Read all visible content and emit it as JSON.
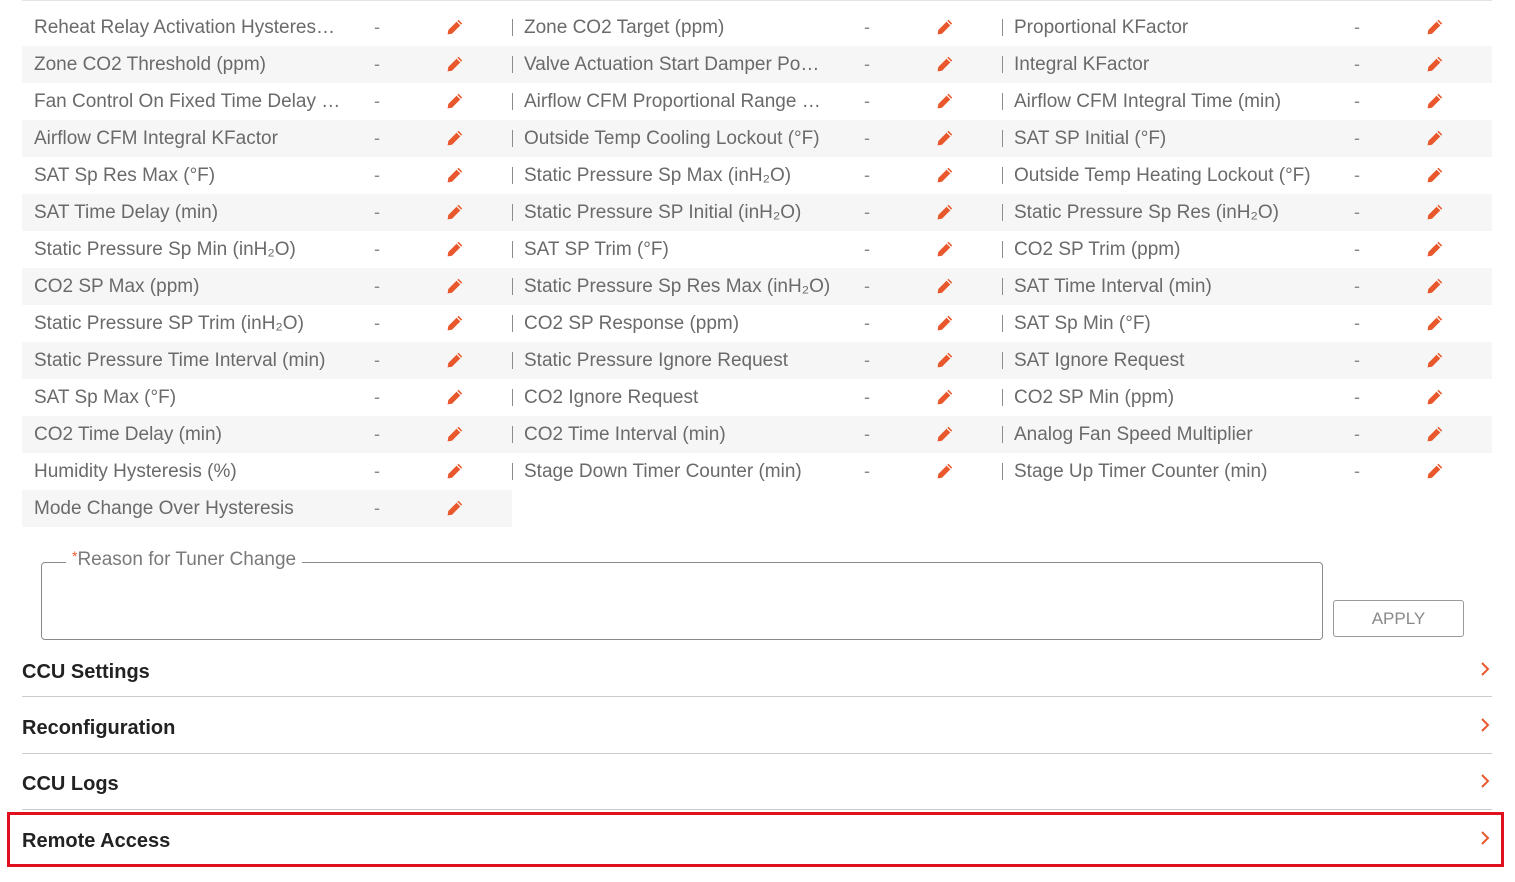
{
  "colors": {
    "accent": "#e8582c",
    "highlight": "#e0101e"
  },
  "tuners": [
    [
      {
        "label": "Reheat Relay Activation Hysteres…",
        "value": "-"
      },
      {
        "label": "Zone CO2 Target (ppm)",
        "value": "-"
      },
      {
        "label": "Proportional KFactor",
        "value": "-"
      }
    ],
    [
      {
        "label": "Zone CO2 Threshold (ppm)",
        "value": "-"
      },
      {
        "label": "Valve Actuation Start Damper Po…",
        "value": "-"
      },
      {
        "label": "Integral KFactor",
        "value": "-"
      }
    ],
    [
      {
        "label": "Fan Control On Fixed Time Delay …",
        "value": "-"
      },
      {
        "label": "Airflow CFM Proportional Range …",
        "value": "-"
      },
      {
        "label": "Airflow CFM Integral Time (min)",
        "value": "-"
      }
    ],
    [
      {
        "label": "Airflow CFM Integral KFactor",
        "value": "-"
      },
      {
        "label": "Outside Temp Cooling Lockout (°F)",
        "value": "-"
      },
      {
        "label": "SAT SP Initial (°F)",
        "value": "-"
      }
    ],
    [
      {
        "label": "SAT Sp Res Max (°F)",
        "value": "-"
      },
      {
        "label": "Static Pressure Sp Max (inH₂O)",
        "value": "-"
      },
      {
        "label": "Outside Temp Heating Lockout (°F)",
        "value": "-"
      }
    ],
    [
      {
        "label": "SAT Time Delay (min)",
        "value": "-"
      },
      {
        "label": "Static Pressure SP Initial (inH₂O)",
        "value": "-"
      },
      {
        "label": "Static Pressure Sp Res (inH₂O)",
        "value": "-"
      }
    ],
    [
      {
        "label": "Static Pressure Sp Min (inH₂O)",
        "value": "-"
      },
      {
        "label": "SAT SP Trim (°F)",
        "value": "-"
      },
      {
        "label": "CO2 SP Trim (ppm)",
        "value": "-"
      }
    ],
    [
      {
        "label": "CO2 SP Max (ppm)",
        "value": "-"
      },
      {
        "label": "Static Pressure Sp Res Max (inH₂O)",
        "value": "-"
      },
      {
        "label": "SAT Time Interval (min)",
        "value": "-"
      }
    ],
    [
      {
        "label": "Static Pressure SP Trim (inH₂O)",
        "value": "-"
      },
      {
        "label": "CO2 SP Response (ppm)",
        "value": "-"
      },
      {
        "label": "SAT Sp Min (°F)",
        "value": "-"
      }
    ],
    [
      {
        "label": "Static Pressure Time Interval (min)",
        "value": "-"
      },
      {
        "label": "Static Pressure Ignore Request",
        "value": "-"
      },
      {
        "label": "SAT Ignore Request",
        "value": "-"
      }
    ],
    [
      {
        "label": "SAT Sp Max (°F)",
        "value": "-"
      },
      {
        "label": "CO2 Ignore Request",
        "value": "-"
      },
      {
        "label": "CO2 SP Min (ppm)",
        "value": "-"
      }
    ],
    [
      {
        "label": "CO2 Time Delay (min)",
        "value": "-"
      },
      {
        "label": "CO2 Time Interval (min)",
        "value": "-"
      },
      {
        "label": "Analog Fan Speed Multiplier",
        "value": "-"
      }
    ],
    [
      {
        "label": "Humidity Hysteresis (%)",
        "value": "-"
      },
      {
        "label": "Stage Down Timer Counter (min)",
        "value": "-"
      },
      {
        "label": "Stage Up Timer Counter (min)",
        "value": "-"
      }
    ],
    [
      {
        "label": "Mode Change Over Hysteresis",
        "value": "-"
      }
    ]
  ],
  "reason": {
    "required_mark": "*",
    "label": "Reason for Tuner Change",
    "value": ""
  },
  "apply_label": "APPLY",
  "sections": [
    {
      "title": "CCU Settings"
    },
    {
      "title": "Reconfiguration"
    },
    {
      "title": "CCU Logs"
    },
    {
      "title": "Remote Access"
    }
  ]
}
